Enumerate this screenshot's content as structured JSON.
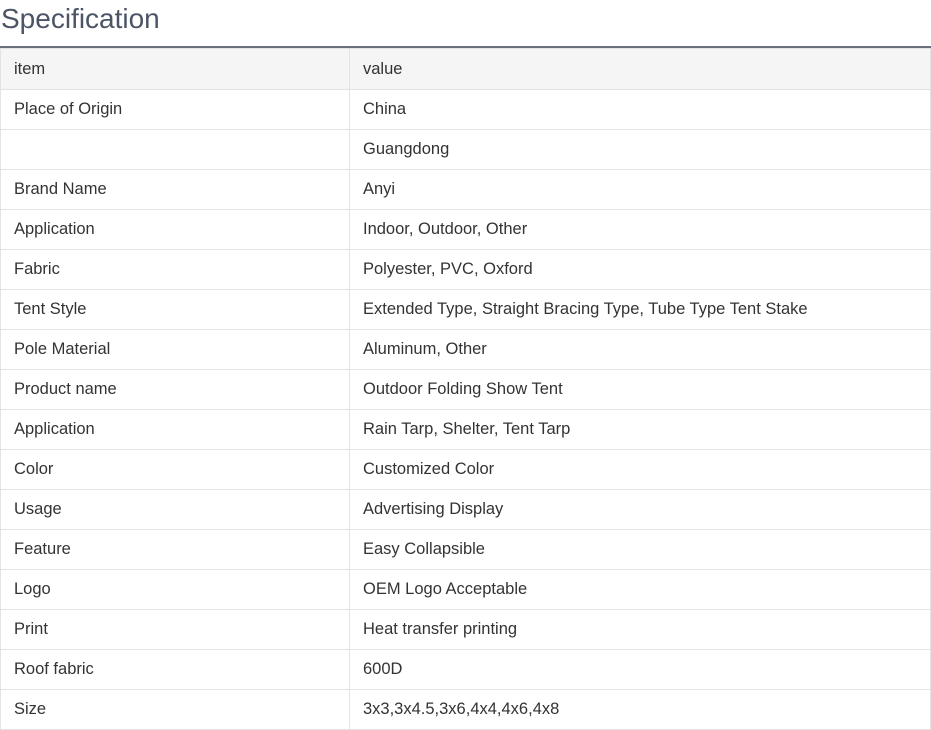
{
  "title": "Specification",
  "table": {
    "header": {
      "item": "item",
      "value": "value"
    },
    "rows": [
      {
        "item": "Place of Origin",
        "value": "China"
      },
      {
        "item": "",
        "value": "Guangdong"
      },
      {
        "item": "Brand Name",
        "value": "Anyi"
      },
      {
        "item": "Application",
        "value": "Indoor, Outdoor, Other"
      },
      {
        "item": "Fabric",
        "value": "Polyester, PVC, Oxford"
      },
      {
        "item": "Tent Style",
        "value": "Extended Type, Straight Bracing Type, Tube Type Tent Stake"
      },
      {
        "item": "Pole Material",
        "value": "Aluminum, Other"
      },
      {
        "item": "Product name",
        "value": "Outdoor Folding Show Tent"
      },
      {
        "item": "Application",
        "value": "Rain Tarp, Shelter, Tent Tarp"
      },
      {
        "item": "Color",
        "value": "Customized Color"
      },
      {
        "item": "Usage",
        "value": "Advertising Display"
      },
      {
        "item": "Feature",
        "value": "Easy Collapsible"
      },
      {
        "item": "Logo",
        "value": "OEM Logo Acceptable"
      },
      {
        "item": "Print",
        "value": "Heat transfer printing"
      },
      {
        "item": "Roof fabric",
        "value": "600D"
      },
      {
        "item": "Size",
        "value": "3x3,3x4.5,3x6,4x4,4x6,4x8"
      }
    ]
  }
}
